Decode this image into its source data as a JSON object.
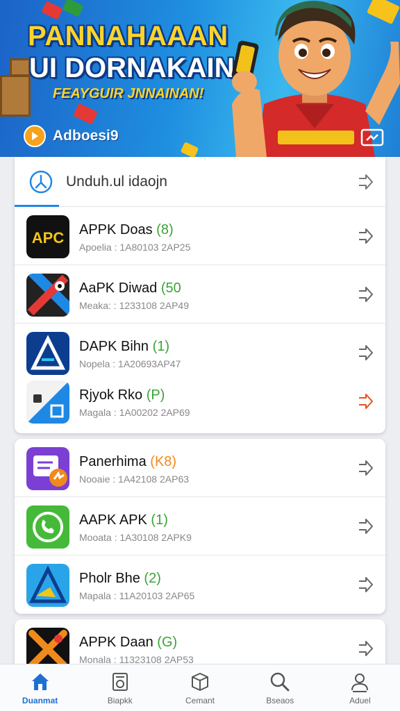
{
  "banner": {
    "title_line1": "PANNAHAAAN",
    "title_line2": "UI DORNAKAIN",
    "subtitle": "FEAYGUIR JNNAINAN!",
    "chip_label": "Adboesi9"
  },
  "search": {
    "text": "Unduh.ul idaojn"
  },
  "apps": [
    {
      "name": "APPK Doas",
      "tag": "(8)",
      "tag_color": "#3aa335",
      "meta": "Apoelia : 1A80103 2AP25",
      "arrow_color": "#666666",
      "icon": "apc-icon",
      "icon_text": "APC"
    },
    {
      "name": "AaPK Diwad",
      "tag": "(50",
      "tag_color": "#3aa335",
      "meta": "Meaka: : 1233108 2AP49",
      "arrow_color": "#666666",
      "icon": "x-cross-icon"
    },
    {
      "name": "DAPK Bihn",
      "tag": "(1)",
      "tag_color": "#3aa335",
      "meta": "Nopela : 1A20693AP47",
      "arrow_color": "#666666",
      "icon": "triangle-a-icon"
    },
    {
      "name": "Rjyok Rko",
      "tag": "(P)",
      "tag_color": "#3aa335",
      "meta": "Magala : 1A00202 2AP69",
      "arrow_color": "#e8501c",
      "icon": "map-icon"
    },
    {
      "name": "Panerhima",
      "tag": "(K8)",
      "tag_color": "#f08a1c",
      "meta": "Nooaie : 1A42108 2AP63",
      "arrow_color": "#666666",
      "icon": "messenger-icon"
    },
    {
      "name": "AAPK APK",
      "tag": "(1)",
      "tag_color": "#3aa335",
      "meta": "Mooata : 1A30108 2APK9",
      "arrow_color": "#666666",
      "icon": "phone-leaf-icon"
    },
    {
      "name": "Pholr Bhe",
      "tag": "(2)",
      "tag_color": "#3aa335",
      "meta": "Mapala : 11A20103 2AP65",
      "arrow_color": "#666666",
      "icon": "blue-a-icon"
    },
    {
      "name": "APPK Daan",
      "tag": "(G)",
      "tag_color": "#3aa335",
      "meta": "Monala : 11323108 2AP53",
      "arrow_color": "#666666",
      "icon": "orange-x-icon"
    }
  ],
  "nav": [
    {
      "label": "Duanmat",
      "icon": "home-icon",
      "active": true
    },
    {
      "label": "Biapkk",
      "icon": "book-icon",
      "active": false
    },
    {
      "label": "Cemant",
      "icon": "box-icon",
      "active": false
    },
    {
      "label": "Bseaos",
      "icon": "search-icon",
      "active": false
    },
    {
      "label": "Aduel",
      "icon": "user-icon",
      "active": false
    }
  ],
  "colors": {
    "accent": "#1e6fd1",
    "banner_title": "#ffd42a",
    "tag_green": "#3aa335",
    "tag_orange": "#f08a1c",
    "arrow_orange": "#e8501c"
  }
}
